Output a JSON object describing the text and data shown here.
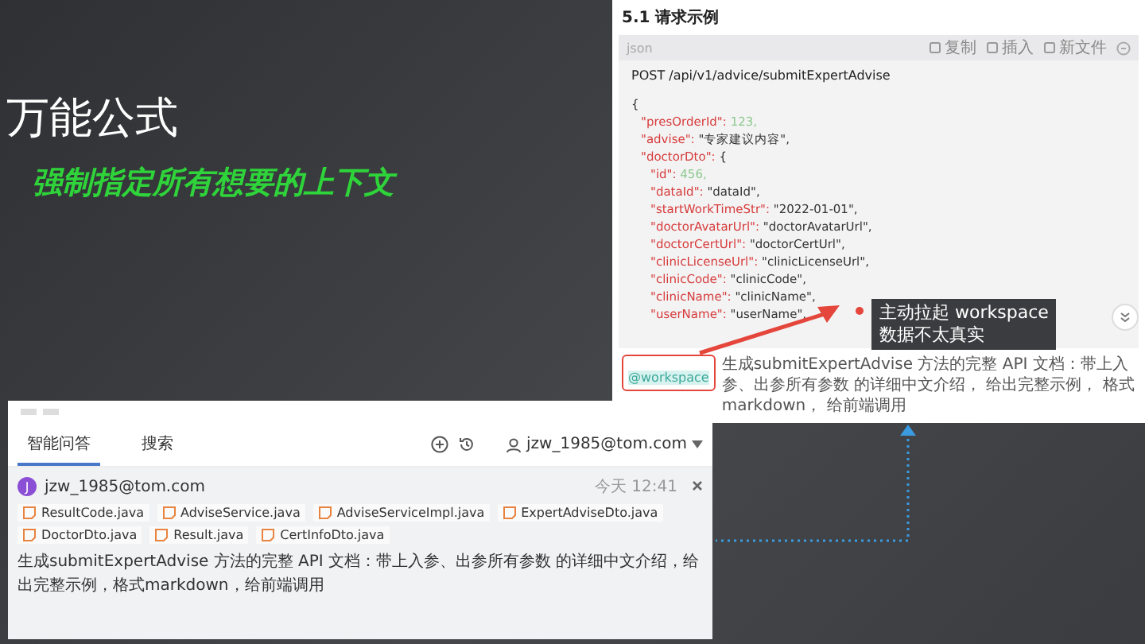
{
  "slide": {
    "title": "万能公式",
    "subtitle": "强制指定所有想要的上下文"
  },
  "doc_panel": {
    "heading": "5.1 请求示例",
    "code_block": {
      "language": "json",
      "actions": [
        {
          "label": "复制"
        },
        {
          "label": "插入"
        },
        {
          "label": "新文件"
        }
      ],
      "request_line": "POST /api/v1/advice/submitExpertAdvise",
      "lines": [
        {
          "kind": "brace",
          "value": "{"
        },
        {
          "kind": "number",
          "key": "\"presOrderId\": ",
          "value": "123,"
        },
        {
          "kind": "string",
          "key": "\"advise\": ",
          "value": "\"专家建议内容\","
        },
        {
          "kind": "brace",
          "key": "\"doctorDto\": ",
          "value": "{"
        },
        {
          "kind": "number",
          "key": "\"id\": ",
          "value": "456,"
        },
        {
          "kind": "string",
          "key": "\"dataId\": ",
          "value": "\"dataId\","
        },
        {
          "kind": "string",
          "key": "\"startWorkTimeStr\": ",
          "value": "\"2022-01-01\","
        },
        {
          "kind": "string",
          "key": "\"doctorAvatarUrl\": ",
          "value": "\"doctorAvatarUrl\","
        },
        {
          "kind": "string",
          "key": "\"doctorCertUrl\": ",
          "value": "\"doctorCertUrl\","
        },
        {
          "kind": "string",
          "key": "\"clinicLicenseUrl\": ",
          "value": "\"clinicLicenseUrl\","
        },
        {
          "kind": "string",
          "key": "\"clinicCode\": ",
          "value": "\"clinicCode\","
        },
        {
          "kind": "string",
          "key": "\"clinicName\": ",
          "value": "\"clinicName\","
        },
        {
          "kind": "string",
          "key": "\"userName\": ",
          "value": "\"userName\","
        }
      ]
    },
    "prompt": {
      "mention": "@workspace",
      "text": "生成submitExpertAdvise 方法的完整 API 文档：带上入参、出参所有参数 的详细中文介绍， 给出完整示例， 格式markdown， 给前端调用"
    }
  },
  "annotation": {
    "lines": [
      "主动拉起 workspace",
      "数据不太真实"
    ]
  },
  "chat_panel": {
    "tabs": [
      {
        "label": "智能问答",
        "selected": true
      },
      {
        "label": "搜索",
        "selected": false
      }
    ],
    "account": "jzw_1985@tom.com",
    "message": {
      "avatar_letter": "J",
      "author": "jzw_1985@tom.com",
      "time": "今天 12:41",
      "files": [
        "ResultCode.java",
        "AdviseService.java",
        "AdviseServiceImpl.java",
        "ExpertAdviseDto.java",
        "DoctorDto.java",
        "Result.java",
        "CertInfoDto.java"
      ],
      "text": "生成submitExpertAdvise 方法的完整 API 文档：带上入参、出参所有参数 的详细中文介绍，给出完整示例，格式markdown，给前端调用"
    }
  }
}
